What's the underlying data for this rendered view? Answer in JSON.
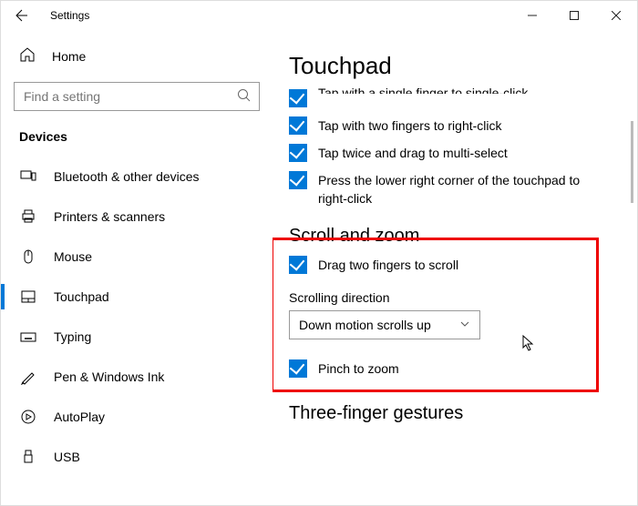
{
  "window": {
    "title": "Settings"
  },
  "sidebar": {
    "home_label": "Home",
    "search_placeholder": "Find a setting",
    "group_label": "Devices",
    "items": [
      {
        "label": "Bluetooth & other devices"
      },
      {
        "label": "Printers & scanners"
      },
      {
        "label": "Mouse"
      },
      {
        "label": "Touchpad"
      },
      {
        "label": "Typing"
      },
      {
        "label": "Pen & Windows Ink"
      },
      {
        "label": "AutoPlay"
      },
      {
        "label": "USB"
      }
    ]
  },
  "content": {
    "page_title": "Touchpad",
    "taps": {
      "truncated_label": "Tap with a single finger to single-click",
      "items": [
        {
          "label": "Tap with two fingers to right-click",
          "checked": true
        },
        {
          "label": "Tap twice and drag to multi-select",
          "checked": true
        },
        {
          "label": "Press the lower right corner of the touchpad to right-click",
          "checked": true
        }
      ]
    },
    "scroll_zoom": {
      "title": "Scroll and zoom",
      "drag_label": "Drag two fingers to scroll",
      "direction_label": "Scrolling direction",
      "direction_value": "Down motion scrolls up",
      "pinch_label": "Pinch to zoom"
    },
    "three_finger": {
      "title": "Three-finger gestures"
    }
  },
  "colors": {
    "accent": "#0078d7",
    "highlight": "#e00"
  }
}
